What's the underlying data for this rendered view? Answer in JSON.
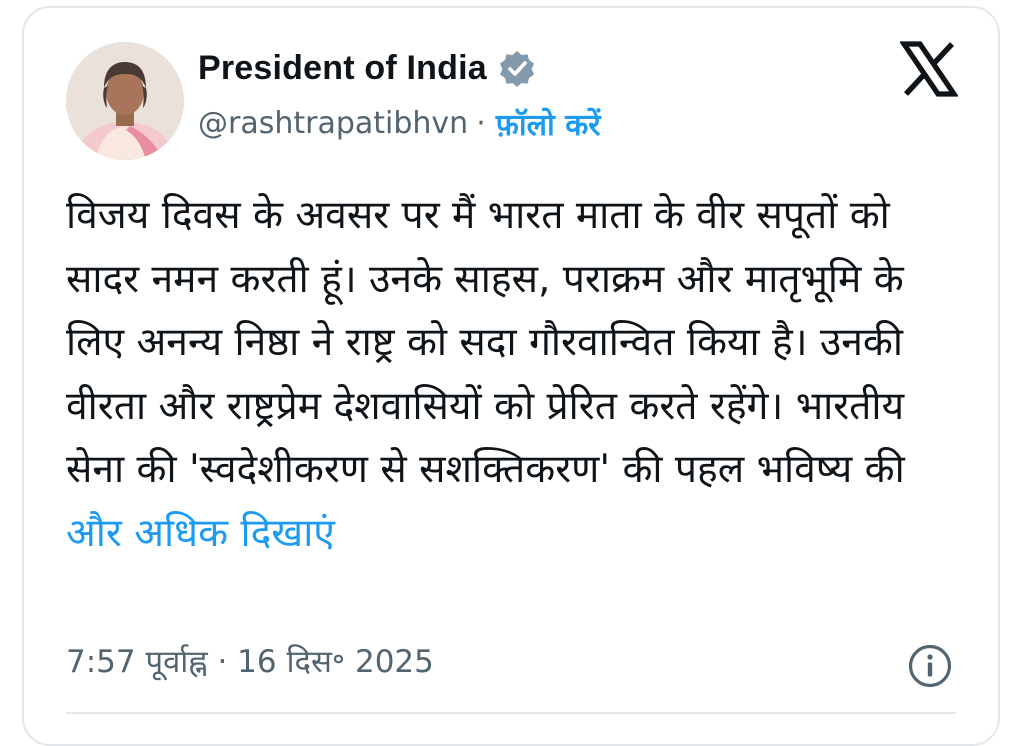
{
  "author": {
    "name": "President of India",
    "handle": "@rashtrapatibhvn",
    "separator": "·",
    "follow_label": "फ़ॉलो करें",
    "verified_color": "#829aab"
  },
  "platform_icon": "x-logo-icon",
  "tweet": {
    "text": "विजय दिवस के अवसर पर मैं भारत माता के वीर सपूतों को सादर नमन करती हूं। उनके साहस, पराक्रम और मातृभूमि के लिए अनन्य निष्ठा ने राष्ट्र को सदा गौरवान्वित किया है। उनकी वीरता और राष्ट्रप्रेम देशवासियों को प्रेरित करते रहेंगे। भारतीय सेना की 'स्वदेशीकरण से सशक्तिकरण' की पहल भविष्य की",
    "show_more_label": "और अधिक दिखाएं"
  },
  "meta": {
    "timestamp": "7:57 पूर्वाह्न · 16 दिस॰ 2025"
  },
  "colors": {
    "link": "#1d9bf0",
    "secondary_text": "#536471",
    "primary_text": "#0f1419",
    "border": "#e3e7ea"
  }
}
